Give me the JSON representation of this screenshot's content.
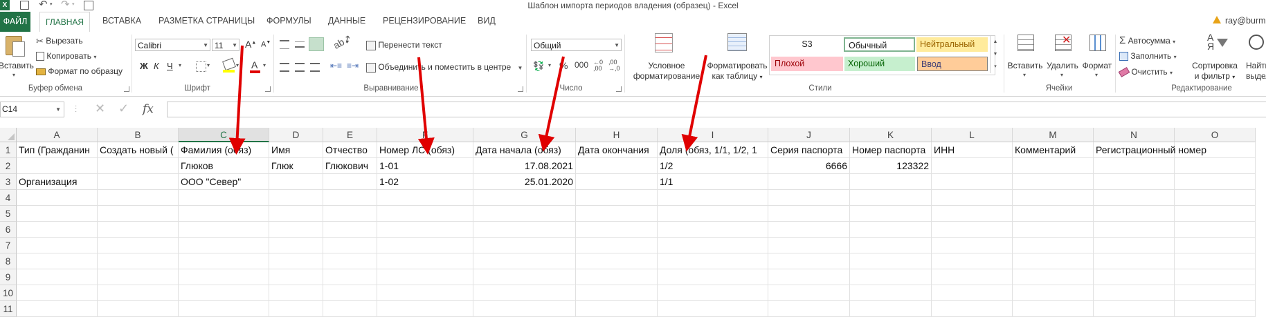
{
  "window": {
    "title": "Шаблон импорта периодов владения (образец) - Excel",
    "user": "ray@burm"
  },
  "tabs": {
    "file": "ФАЙЛ",
    "home": "ГЛАВНАЯ",
    "insert": "ВСТАВКА",
    "layout": "РАЗМЕТКА СТРАНИЦЫ",
    "formulas": "ФОРМУЛЫ",
    "data": "ДАННЫЕ",
    "review": "РЕЦЕНЗИРОВАНИЕ",
    "view": "ВИД"
  },
  "ribbon": {
    "clipboard": {
      "paste": "Вставить",
      "cut": "Вырезать",
      "copy": "Копировать",
      "format_painter": "Формат по образцу",
      "label": "Буфер обмена"
    },
    "font": {
      "name": "Calibri",
      "size": "11",
      "grow": "A",
      "shrink": "A",
      "bold": "Ж",
      "italic": "К",
      "underline": "Ч",
      "font_color_letter": "A",
      "label": "Шрифт"
    },
    "alignment": {
      "wrap": "Перенести текст",
      "merge": "Объединить и поместить в центре",
      "label": "Выравнивание"
    },
    "number": {
      "format": "Общий",
      "label": "Число"
    },
    "styles": {
      "conditional_line1": "Условное",
      "conditional_line2": "форматирование",
      "as_table_line1": "Форматировать",
      "as_table_line2": "как таблицу",
      "cells": [
        {
          "text": "S3",
          "bg": "#ffffff",
          "fg": "#222222",
          "border": "#ffffff"
        },
        {
          "text": "Обычный",
          "bg": "#ffffff",
          "fg": "#222222",
          "border": "#7fb490"
        },
        {
          "text": "Нейтральный",
          "bg": "#ffeb9c",
          "fg": "#9c6500",
          "border": "#ffeb9c"
        },
        {
          "text": "Плохой",
          "bg": "#ffc7ce",
          "fg": "#9c0006",
          "border": "#ffc7ce"
        },
        {
          "text": "Хороший",
          "bg": "#c6efce",
          "fg": "#006100",
          "border": "#c6efce"
        },
        {
          "text": "Ввод",
          "bg": "#ffcc99",
          "fg": "#3f3f76",
          "border": "#7f7f7f"
        }
      ],
      "label": "Стили"
    },
    "cells": {
      "insert": "Вставить",
      "delete": "Удалить",
      "format": "Формат",
      "label": "Ячейки"
    },
    "editing": {
      "autosum": "Автосумма",
      "fill": "Заполнить",
      "clear": "Очистить",
      "sort_line1": "Сортировка",
      "sort_line2": "и фильтр",
      "find_line1": "Найти",
      "find_line2": "выдели",
      "label": "Редактирование"
    }
  },
  "formula_bar": {
    "name_box": "C14",
    "fx": "fx",
    "content": ""
  },
  "sheet": {
    "selected_column": "C",
    "columns": [
      "A",
      "B",
      "C",
      "D",
      "E",
      "F",
      "G",
      "H",
      "I",
      "J",
      "K",
      "L",
      "M",
      "N",
      "O"
    ],
    "rows": [
      "1",
      "2",
      "3",
      "4",
      "5",
      "6",
      "7",
      "8",
      "9",
      "10",
      "11"
    ],
    "header_row": [
      "Тип (Гражданин",
      "Создать новый (",
      "Фамилия (обяз)",
      "Имя",
      "Отчество",
      "Номер ЛС (обяз)",
      "Дата начала (обяз)",
      "Дата окончания",
      "Доля (обяз, 1/1, 1/2, 1",
      "Серия паспорта",
      "Номер паспорта",
      "ИНН",
      "Комментарий",
      "Регистрационный номер",
      ""
    ],
    "data_rows": [
      [
        "",
        "",
        "Глюков",
        "Глюк",
        "Глюкович",
        "1-01",
        "17.08.2021",
        "",
        "1/2",
        "6666",
        "123322",
        "",
        "",
        "",
        ""
      ],
      [
        "Организация",
        "",
        "ООО \"Север\"",
        "",
        "",
        "1-02",
        "25.01.2020",
        "",
        "1/1",
        "",
        "",
        "",
        "",
        "",
        ""
      ]
    ]
  },
  "colors": {
    "accent": "#217346",
    "arrow": "#e00000"
  }
}
